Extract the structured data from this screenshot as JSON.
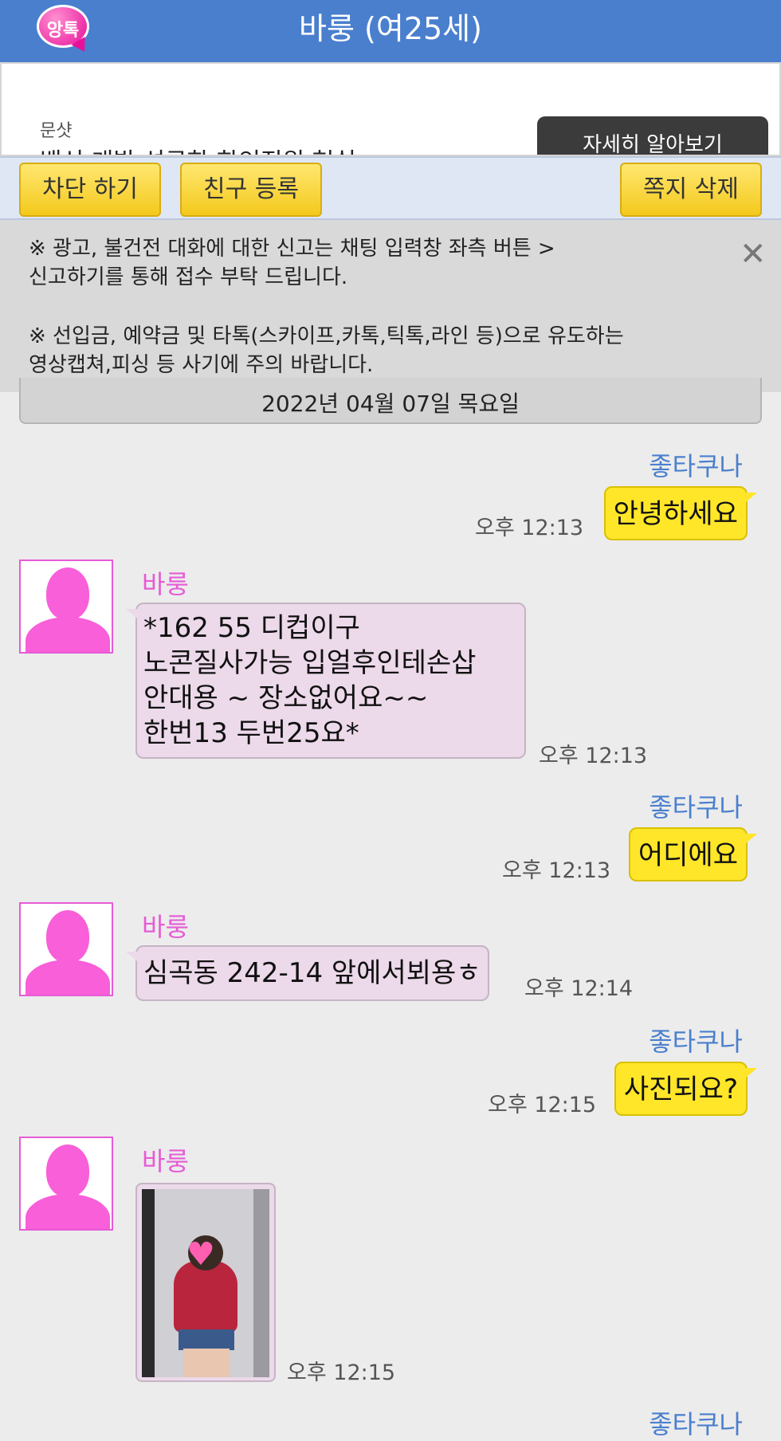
{
  "header": {
    "logo_text": "앙톡",
    "title": "바룽 (여25세)"
  },
  "ad": {
    "brand": "문샷",
    "headline": "백신 개발 성공한 한인직원 현실",
    "cta": "자세히 알아보기"
  },
  "actions": {
    "block": "차단 하기",
    "add_friend": "친구 등록",
    "delete_message": "쪽지 삭제"
  },
  "notice": {
    "line1": "※ 광고, 불건전 대화에 대한 신고는 채팅 입력창 좌측 버튼 >",
    "line2": "신고하기를 통해 접수 부탁 드립니다.",
    "line3": "※ 선입금, 예약금 및 타톡(스카이프,카톡,틱톡,라인 등)으로 유도하는",
    "line4": "영상캡쳐,피싱 등 사기에 주의 바랍니다.",
    "close_icon": "close-icon"
  },
  "date": "2022년 04월 07일 목요일",
  "messages": [
    {
      "from": "me",
      "sender": "좋타쿠나",
      "text": "안녕하세요",
      "time": "오후 12:13"
    },
    {
      "from": "her",
      "sender": "바룽",
      "lines": [
        "*162  55 디컵이구",
        "노콘질사가능  입얼후인테손삽",
        "안대용 ~ 장소없어요~~",
        "한번13 두번25요*"
      ],
      "time": "오후 12:13"
    },
    {
      "from": "me",
      "sender": "좋타쿠나",
      "text": "어디에요",
      "time": "오후 12:13"
    },
    {
      "from": "her",
      "sender": "바룽",
      "text": "심곡동 242-14 앞에서뵈용ㅎ",
      "time": "오후 12:14"
    },
    {
      "from": "me",
      "sender": "좋타쿠나",
      "text": "사진되요?",
      "time": "오후 12:15"
    },
    {
      "from": "her",
      "sender": "바룽",
      "time": "오후 12:15"
    },
    {
      "from": "me",
      "sender": "좋타쿠나"
    }
  ],
  "colors": {
    "header": "#4a7fce",
    "my_bubble": "#ffe629",
    "her_bubble": "#ecd9ea",
    "her_name": "#e65bd6"
  }
}
